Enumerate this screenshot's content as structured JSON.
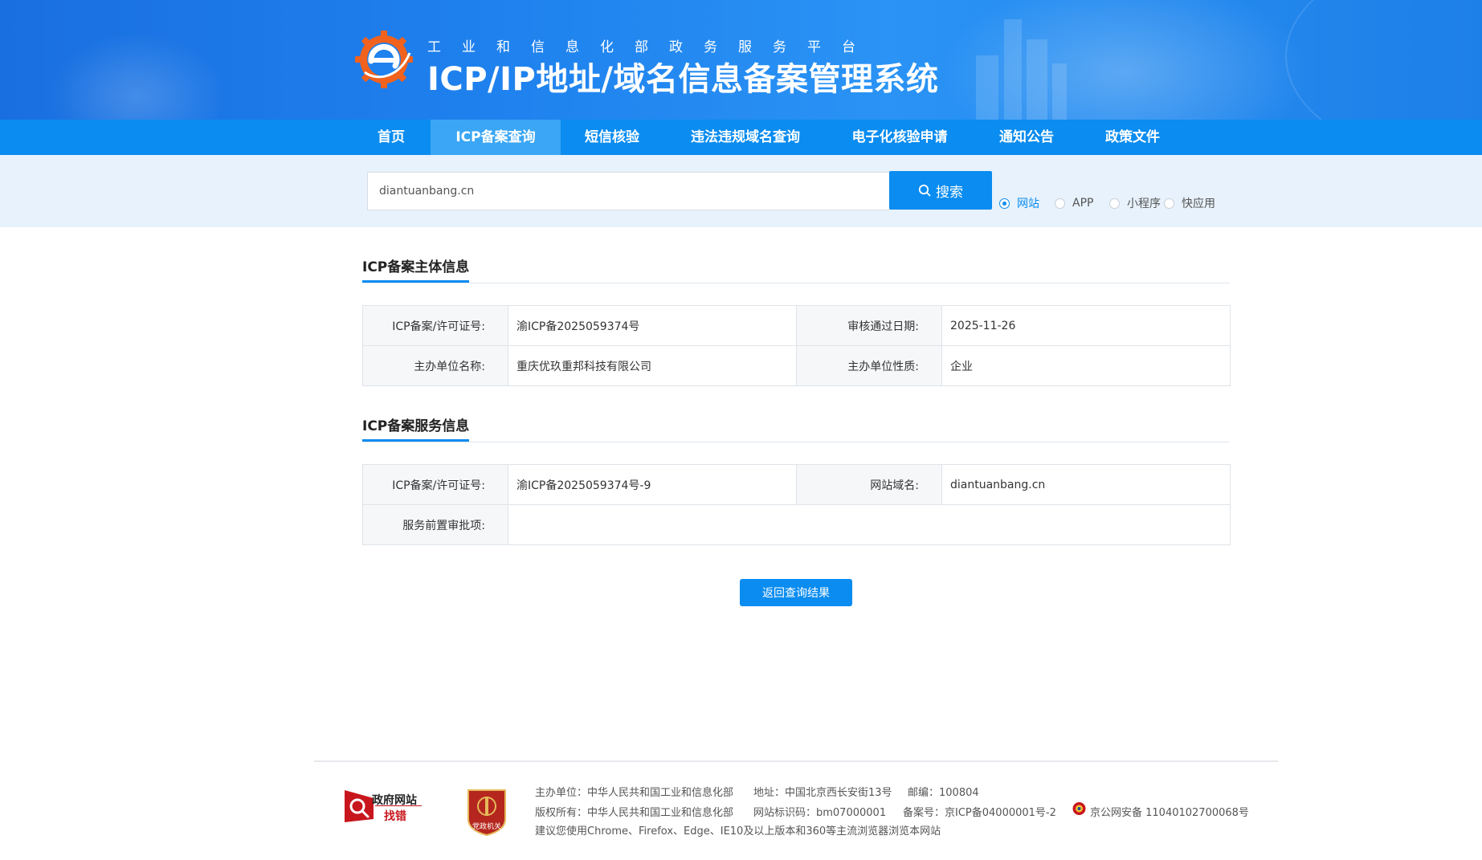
{
  "header": {
    "subtitle": "工业和信息化部政务服务平台",
    "title": "ICP/IP地址/域名信息备案管理系统"
  },
  "nav": [
    {
      "label": "首页"
    },
    {
      "label": "ICP备案查询"
    },
    {
      "label": "短信核验"
    },
    {
      "label": "违法违规域名查询"
    },
    {
      "label": "电子化核验申请"
    },
    {
      "label": "通知公告"
    },
    {
      "label": "政策文件"
    }
  ],
  "nav_active": "ICP备案查询",
  "search": {
    "value": "diantuanbang.cn",
    "button_label": "搜索",
    "types": [
      {
        "label": "网站",
        "checked": true
      },
      {
        "label": "APP",
        "checked": false
      },
      {
        "label": "小程序",
        "checked": false
      },
      {
        "label": "快应用",
        "checked": false
      }
    ]
  },
  "subject_section": {
    "title": "ICP备案主体信息",
    "license_label": "ICP备案/许可证号:",
    "license_value": "渝ICP备2025059374号",
    "approve_date_label": "审核通过日期:",
    "approve_date_value": "2025-11-26",
    "org_name_label": "主办单位名称:",
    "org_name_value": "重庆优玖重邦科技有限公司",
    "org_type_label": "主办单位性质:",
    "org_type_value": "企业"
  },
  "service_section": {
    "title": "ICP备案服务信息",
    "license_label": "ICP备案/许可证号:",
    "license_value": "渝ICP备2025059374号-9",
    "domain_label": "网站域名:",
    "domain_value": "diantuanbang.cn",
    "preapproval_label": "服务前置审批项:",
    "preapproval_value": ""
  },
  "return_button": "返回查询结果",
  "footer": {
    "gov_find_line1": "政府网站",
    "gov_find_line2": "找错",
    "badge_text": "党政机关",
    "host": "主办单位：中华人民共和国工业和信息化部",
    "address": "地址：中国北京西长安街13号",
    "postcode": "邮编：100804",
    "copyright": "版权所有：中华人民共和国工业和信息化部",
    "site_id": "网站标识码：bm07000001",
    "icp": "备案号：京ICP备04000001号-2",
    "police": "京公网安备 11040102700068号",
    "browser_tip": "建议您使用Chrome、Firefox、Edge、IE10及以上版本和360等主流浏览器浏览本网站"
  },
  "colors": {
    "primary": "#0a8cf0",
    "nav_active": "#3aa6f5",
    "search_band": "#e7f2fc",
    "logo_orange": "#f0621d"
  }
}
